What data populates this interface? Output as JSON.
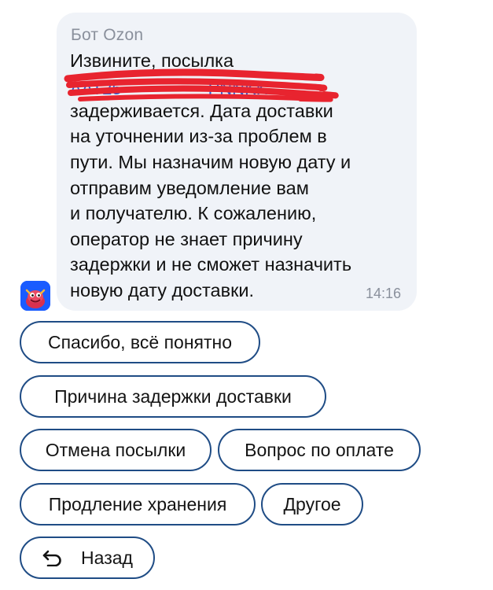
{
  "message": {
    "sender": "Бот Ozon",
    "lines": [
      "Извините, посылка",
      "задерживается. Дата доставки",
      "на уточнении из-за проблем в",
      "пути. Мы назначим новую дату и",
      "отправим уведомление вам",
      "и получателю. К сожалению,",
      "оператор не знает причину",
      "задержки и не сможет назначить",
      "новую дату доставки."
    ],
    "time": "14:16"
  },
  "buttons": {
    "thanks": "Спасибо, всё понятно",
    "delay_reason": "Причина задержки доставки",
    "cancel_parcel": "Отмена посылки",
    "payment_question": "Вопрос по оплате",
    "extend_storage": "Продление хранения",
    "other": "Другое",
    "back": "Назад"
  },
  "colors": {
    "chip_border": "#1f4c85",
    "bubble_background": "#f0f3f8",
    "redaction": "#e8242f",
    "avatar_background": "#1a5cff"
  },
  "icons": {
    "avatar": "ozon-bot-mascot-icon",
    "back": "undo-arrow-icon"
  }
}
